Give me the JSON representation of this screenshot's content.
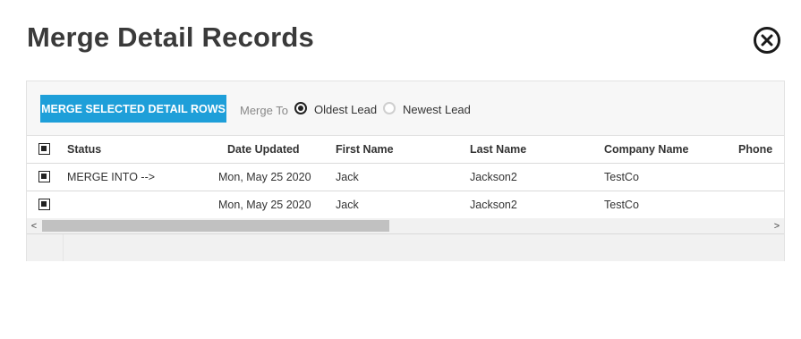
{
  "dialog": {
    "title": "Merge Detail Records",
    "close_icon": "close-circle-icon"
  },
  "toolbar": {
    "merge_button_label": "MERGE SELECTED DETAIL ROWS",
    "merge_to_label": "Merge To",
    "options": [
      {
        "label": "Oldest Lead",
        "selected": true
      },
      {
        "label": "Newest Lead",
        "selected": false
      }
    ]
  },
  "grid": {
    "columns": [
      "Status",
      "Date Updated",
      "First Name",
      "Last Name",
      "Company Name",
      "Phone"
    ],
    "rows": [
      {
        "checked": true,
        "status": "MERGE INTO -->",
        "date_updated": "Mon, May 25 2020",
        "first_name": "Jack",
        "last_name": "Jackson2",
        "company_name": "TestCo",
        "phone": ""
      },
      {
        "checked": true,
        "status": "",
        "date_updated": "Mon, May 25 2020",
        "first_name": "Jack",
        "last_name": "Jackson2",
        "company_name": "TestCo",
        "phone": ""
      }
    ],
    "scroll_left_glyph": "<",
    "scroll_right_glyph": ">"
  },
  "colors": {
    "button_bg": "#1e9fd9",
    "button_text": "#ffffff",
    "toolbar_bg": "#f7f7f7",
    "scrollbar_thumb": "#c1c1c1"
  }
}
